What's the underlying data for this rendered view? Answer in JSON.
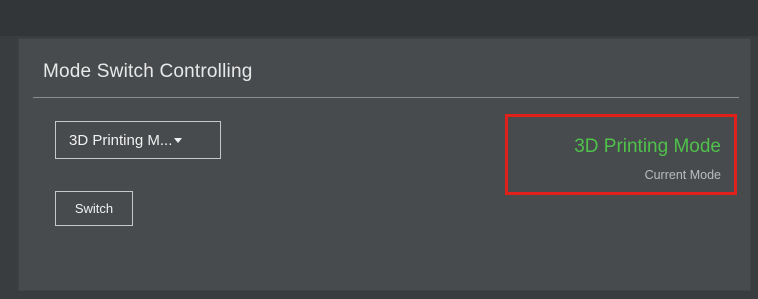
{
  "panel": {
    "title": "Mode Switch Controlling"
  },
  "mode_select": {
    "selected": "3D Printing M...",
    "caret_icon": "caret-down-icon"
  },
  "switch_button": {
    "label": "Switch"
  },
  "status": {
    "current_mode_value": "3D Printing Mode",
    "current_mode_label": "Current Mode",
    "value_color": "#4fc24a",
    "highlight_color": "#e0201a"
  }
}
